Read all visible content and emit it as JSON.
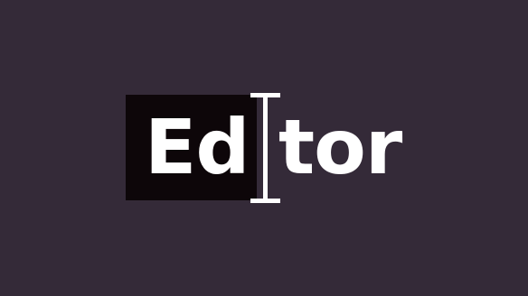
{
  "logo": {
    "text_left": "Ed",
    "text_right": "tor",
    "cursor_icon": "text-cursor-ibeam-icon",
    "colors": {
      "background": "#342a38",
      "highlight": "#0d0609",
      "text": "#ffffff",
      "cursor": "#ffffff"
    }
  }
}
